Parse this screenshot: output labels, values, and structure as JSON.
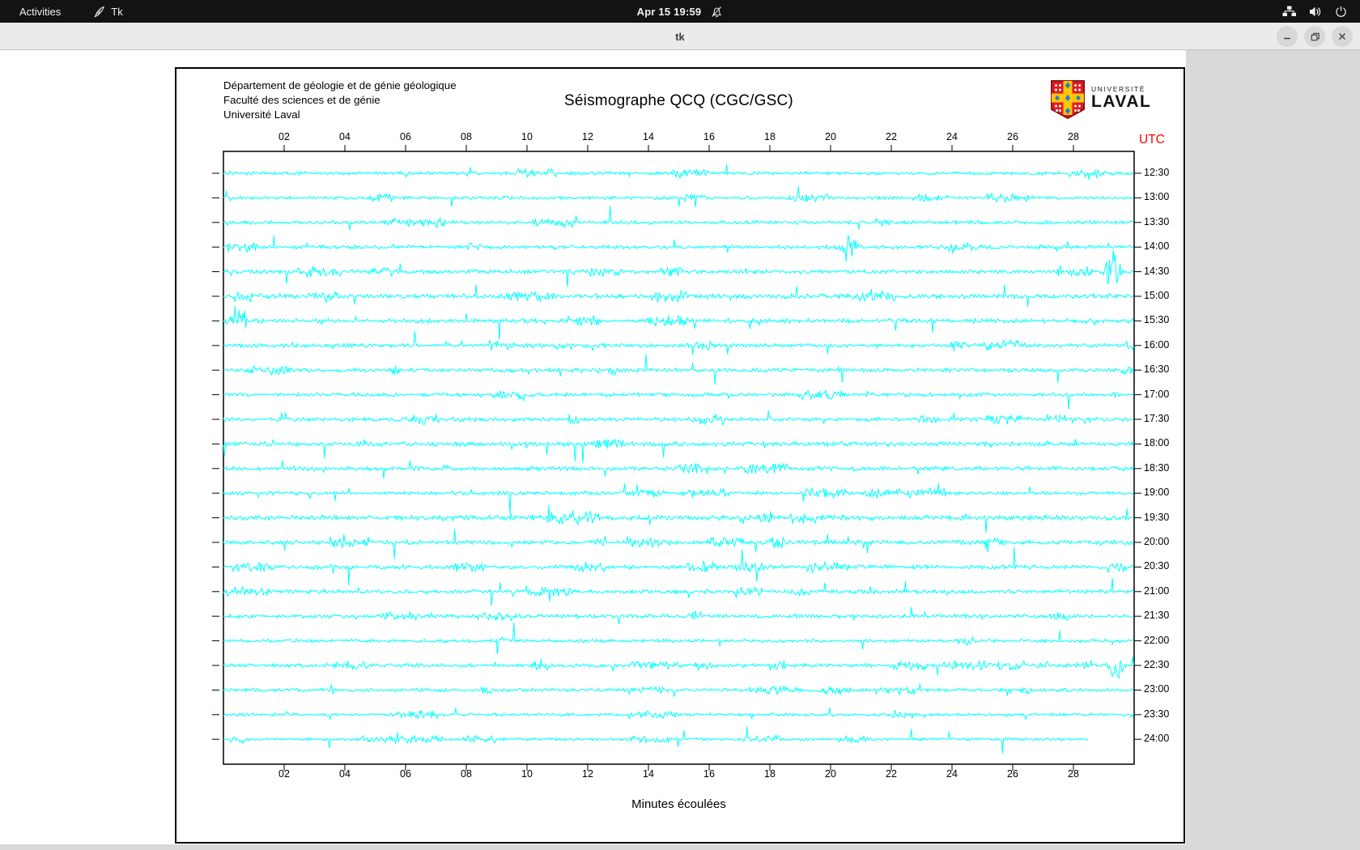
{
  "top_bar": {
    "activities": "Activities",
    "app_indicator": "Tk",
    "clock": "Apr 15 19:59",
    "status_icons": [
      "bell-slash-icon",
      "network-icon",
      "volume-icon",
      "power-icon"
    ]
  },
  "window": {
    "title": "tk"
  },
  "figure": {
    "institution": [
      "Département de géologie et de génie géologique",
      "Faculté des sciences et de génie",
      "Université Laval"
    ],
    "title": "Séismographe QCQ (CGC/GSC)",
    "logo": {
      "line1": "UNIVERSITÉ",
      "line2": "LAVAL",
      "shield_red": "#e11a22",
      "shield_gold": "#ffc609",
      "shield_blue": "#1f7fd0"
    },
    "utc_label": "UTC",
    "utc_color": "#ff0000",
    "xlabel": "Minutes écoulées"
  },
  "chart_data": {
    "type": "line",
    "title": "Séismographe QCQ (CGC/GSC)",
    "xlabel": "Minutes écoulées",
    "x_range_minutes": [
      0,
      30
    ],
    "x_ticks": [
      "02",
      "04",
      "06",
      "08",
      "10",
      "12",
      "14",
      "16",
      "18",
      "20",
      "22",
      "24",
      "26",
      "28"
    ],
    "trace_color": "#00ffff",
    "frame_color": "#000000",
    "rows": [
      {
        "time": "12:30",
        "end_minute": 30,
        "seed": 20,
        "noise": 1.1,
        "spike_rate": 0.009,
        "spike_max": 20
      },
      {
        "time": "13:00",
        "end_minute": 30,
        "seed": 27,
        "noise": 1.0,
        "spike_rate": 0.006,
        "spike_max": 16
      },
      {
        "time": "13:30",
        "end_minute": 30,
        "seed": 34,
        "noise": 1.2,
        "spike_rate": 0.008,
        "spike_max": 18
      },
      {
        "time": "14:00",
        "end_minute": 30,
        "seed": 41,
        "noise": 1.2,
        "spike_rate": 0.009,
        "spike_max": 22,
        "event_minute": 20.6,
        "event_amp": 16
      },
      {
        "time": "14:30",
        "end_minute": 30,
        "seed": 48,
        "noise": 1.3,
        "spike_rate": 0.011,
        "spike_max": 24,
        "event_minute": 29.3,
        "event_amp": 18
      },
      {
        "time": "15:00",
        "end_minute": 30,
        "seed": 55,
        "noise": 1.5,
        "spike_rate": 0.012,
        "spike_max": 22
      },
      {
        "time": "15:30",
        "end_minute": 30,
        "seed": 62,
        "noise": 1.4,
        "spike_rate": 0.012,
        "spike_max": 24,
        "event_minute": 0.5,
        "event_amp": 18
      },
      {
        "time": "16:00",
        "end_minute": 30,
        "seed": 69,
        "noise": 1.3,
        "spike_rate": 0.01,
        "spike_max": 20
      },
      {
        "time": "16:30",
        "end_minute": 30,
        "seed": 76,
        "noise": 1.3,
        "spike_rate": 0.011,
        "spike_max": 22
      },
      {
        "time": "17:00",
        "end_minute": 30,
        "seed": 83,
        "noise": 1.2,
        "spike_rate": 0.01,
        "spike_max": 20
      },
      {
        "time": "17:30",
        "end_minute": 30,
        "seed": 90,
        "noise": 1.3,
        "spike_rate": 0.012,
        "spike_max": 22
      },
      {
        "time": "18:00",
        "end_minute": 30,
        "seed": 97,
        "noise": 1.4,
        "spike_rate": 0.013,
        "spike_max": 22
      },
      {
        "time": "18:30",
        "end_minute": 30,
        "seed": 104,
        "noise": 1.4,
        "spike_rate": 0.012,
        "spike_max": 24
      },
      {
        "time": "19:00",
        "end_minute": 30,
        "seed": 111,
        "noise": 1.2,
        "spike_rate": 0.01,
        "spike_max": 26
      },
      {
        "time": "19:30",
        "end_minute": 30,
        "seed": 118,
        "noise": 1.6,
        "spike_rate": 0.016,
        "spike_max": 26
      },
      {
        "time": "20:00",
        "end_minute": 30,
        "seed": 125,
        "noise": 1.4,
        "spike_rate": 0.012,
        "spike_max": 22
      },
      {
        "time": "20:30",
        "end_minute": 30,
        "seed": 132,
        "noise": 1.3,
        "spike_rate": 0.012,
        "spike_max": 24
      },
      {
        "time": "21:00",
        "end_minute": 30,
        "seed": 139,
        "noise": 1.3,
        "spike_rate": 0.011,
        "spike_max": 22
      },
      {
        "time": "21:30",
        "end_minute": 30,
        "seed": 146,
        "noise": 1.2,
        "spike_rate": 0.011,
        "spike_max": 24
      },
      {
        "time": "22:00",
        "end_minute": 30,
        "seed": 153,
        "noise": 1.1,
        "spike_rate": 0.009,
        "spike_max": 26
      },
      {
        "time": "22:30",
        "end_minute": 30,
        "seed": 160,
        "noise": 1.2,
        "spike_rate": 0.01,
        "spike_max": 22,
        "event_minute": 29.4,
        "event_amp": 14
      },
      {
        "time": "23:00",
        "end_minute": 30,
        "seed": 167,
        "noise": 1.1,
        "spike_rate": 0.008,
        "spike_max": 18
      },
      {
        "time": "23:30",
        "end_minute": 30,
        "seed": 174,
        "noise": 1.0,
        "spike_rate": 0.006,
        "spike_max": 14
      },
      {
        "time": "24:00",
        "end_minute": 28.5,
        "seed": 181,
        "noise": 0.9,
        "spike_rate": 0.005,
        "spike_max": 16
      }
    ]
  }
}
